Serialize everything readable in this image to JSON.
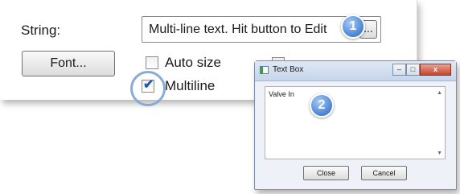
{
  "panel": {
    "string_label": "String:",
    "string_value": "Multi-line text. Hit button to Edit",
    "ellipsis_label": "...",
    "font_button": "Font...",
    "auto_size_label": "Auto size",
    "multiline_label": "Multiline",
    "auto_size_checked": false,
    "multiline_checked": true
  },
  "callouts": {
    "one": "1",
    "two": "2"
  },
  "dialog": {
    "title": "Text Box",
    "text_value": "Valve In",
    "close_button": "Close",
    "cancel_button": "Cancel",
    "minimize_glyph": "–",
    "maximize_glyph": "□",
    "close_glyph": "x",
    "scroll_up_glyph": "▲",
    "scroll_down_glyph": "▼"
  },
  "icons": {
    "checkmark": "✔"
  },
  "colors": {
    "callout_blue": "#5a92dc",
    "highlight_ring": "#89abd8",
    "dialog_close_red": "#c5452c"
  }
}
